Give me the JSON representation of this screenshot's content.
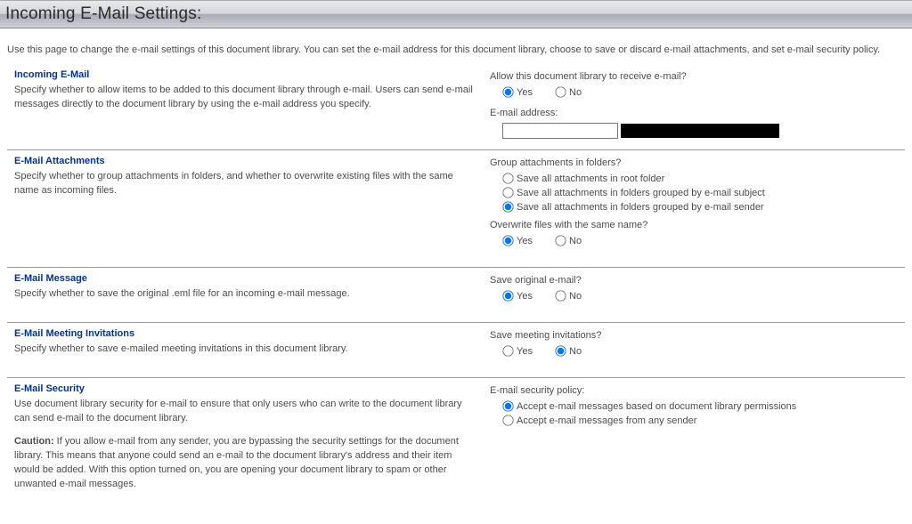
{
  "page_title": "Incoming E-Mail Settings:",
  "description": "Use this page to change the e-mail settings of this document library. You can set the e-mail address for this document library, choose to save or discard e-mail attachments, and set e-mail security policy.",
  "sections": {
    "incoming": {
      "title": "Incoming E-Mail",
      "desc": "Specify whether to allow items to be added to this document library through e-mail. Users can send e-mail messages directly to the document library by using the e-mail address you specify.",
      "q1_label": "Allow this document library to receive e-mail?",
      "yes": "Yes",
      "no": "No",
      "addr_label": "E-mail address:",
      "addr_value": ""
    },
    "attachments": {
      "title": "E-Mail Attachments",
      "desc": "Specify whether to group attachments in folders, and whether to overwrite existing files with the same name as incoming files.",
      "q1_label": "Group attachments in folders?",
      "opt1": "Save all attachments in root folder",
      "opt2": "Save all attachments in folders grouped by e-mail subject",
      "opt3": "Save all attachments in folders grouped by e-mail sender",
      "q2_label": "Overwrite files with the same name?",
      "yes": "Yes",
      "no": "No"
    },
    "message": {
      "title": "E-Mail Message",
      "desc": "Specify whether to save the original .eml file for an incoming e-mail message.",
      "q1_label": "Save original e-mail?",
      "yes": "Yes",
      "no": "No"
    },
    "meeting": {
      "title": "E-Mail Meeting Invitations",
      "desc": "Specify whether to save e-mailed meeting invitations in this document library.",
      "q1_label": "Save meeting invitations?",
      "yes": "Yes",
      "no": "No"
    },
    "security": {
      "title": "E-Mail Security",
      "desc1": "Use document library security for e-mail to ensure that only users who can write to the document library can send e-mail to the document library.",
      "caution_label": "Caution:",
      "desc2": " If you allow e-mail from any sender, you are bypassing the security settings for the document library. This means that anyone could send an e-mail to the document library's address and their item would be added. With this option turned on, you are opening your document library to spam or other unwanted e-mail messages.",
      "q1_label": "E-mail security policy:",
      "opt1": "Accept e-mail messages based on document library permissions",
      "opt2": "Accept e-mail messages from any sender"
    }
  }
}
